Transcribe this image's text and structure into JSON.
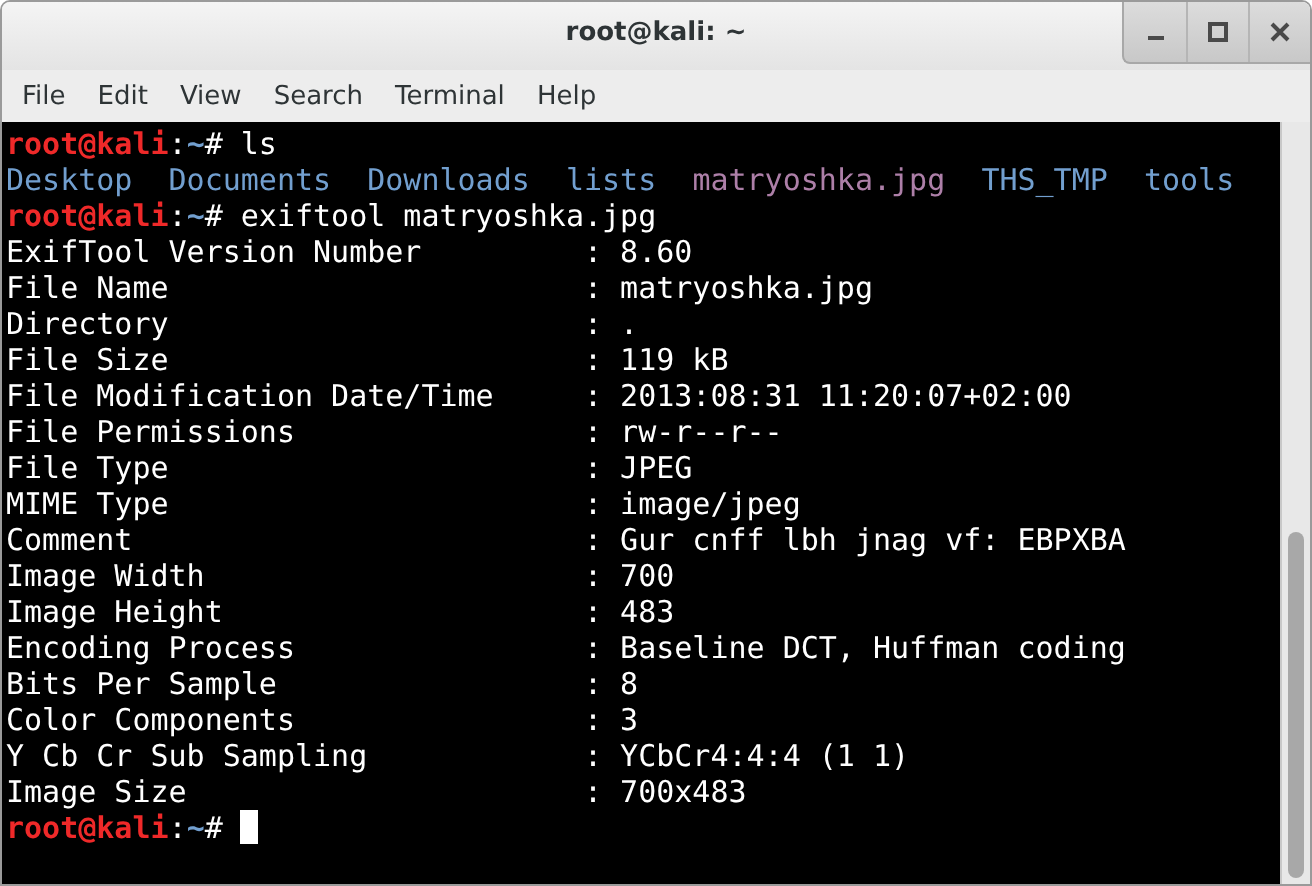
{
  "window": {
    "title": "root@kali: ~"
  },
  "menu": [
    "File",
    "Edit",
    "View",
    "Search",
    "Terminal",
    "Help"
  ],
  "terminal": [
    {
      "kind": "prompt",
      "user": "root@kali",
      "sep": ":",
      "path": "~",
      "symbol": "# ",
      "command": "ls",
      "cursor": false
    },
    {
      "kind": "listing",
      "items": [
        {
          "text": "Desktop",
          "color": "#729fcf"
        },
        {
          "text": "Documents",
          "color": "#729fcf"
        },
        {
          "text": "Downloads",
          "color": "#729fcf"
        },
        {
          "text": "lists",
          "color": "#729fcf"
        },
        {
          "text": "matryoshka.jpg",
          "color": "#ad7fa8"
        },
        {
          "text": "THS_TMP",
          "color": "#729fcf"
        },
        {
          "text": "tools",
          "color": "#729fcf"
        }
      ]
    },
    {
      "kind": "prompt",
      "user": "root@kali",
      "sep": ":",
      "path": "~",
      "symbol": "# ",
      "command": "exiftool matryoshka.jpg",
      "cursor": false
    },
    {
      "kind": "output",
      "text": "ExifTool Version Number         : 8.60"
    },
    {
      "kind": "output",
      "text": "File Name                       : matryoshka.jpg"
    },
    {
      "kind": "output",
      "text": "Directory                       : ."
    },
    {
      "kind": "output",
      "text": "File Size                       : 119 kB"
    },
    {
      "kind": "output",
      "text": "File Modification Date/Time     : 2013:08:31 11:20:07+02:00"
    },
    {
      "kind": "output",
      "text": "File Permissions                : rw-r--r--"
    },
    {
      "kind": "output",
      "text": "File Type                       : JPEG"
    },
    {
      "kind": "output",
      "text": "MIME Type                       : image/jpeg"
    },
    {
      "kind": "output",
      "text": "Comment                         : Gur cnff lbh jnag vf: EBPXBA"
    },
    {
      "kind": "output",
      "text": "Image Width                     : 700"
    },
    {
      "kind": "output",
      "text": "Image Height                    : 483"
    },
    {
      "kind": "output",
      "text": "Encoding Process                : Baseline DCT, Huffman coding"
    },
    {
      "kind": "output",
      "text": "Bits Per Sample                 : 8"
    },
    {
      "kind": "output",
      "text": "Color Components                : 3"
    },
    {
      "kind": "output",
      "text": "Y Cb Cr Sub Sampling            : YCbCr4:4:4 (1 1)"
    },
    {
      "kind": "output",
      "text": "Image Size                      : 700x483"
    },
    {
      "kind": "prompt",
      "user": "root@kali",
      "sep": ":",
      "path": "~",
      "symbol": "# ",
      "cursor": true
    }
  ]
}
